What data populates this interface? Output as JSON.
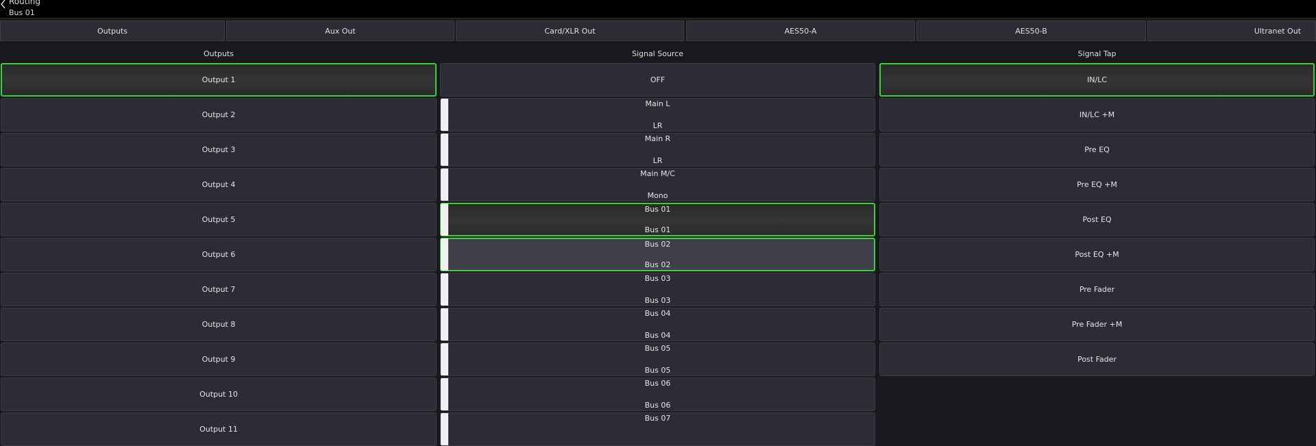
{
  "header": {
    "title": "Routing",
    "subtitle": "Bus 01"
  },
  "tabs": [
    {
      "label": "Outputs",
      "active": true
    },
    {
      "label": "Aux Out"
    },
    {
      "label": "Card/XLR Out"
    },
    {
      "label": "AES50-A"
    },
    {
      "label": "AES50-B"
    },
    {
      "label": "Ultranet Out"
    }
  ],
  "columns": {
    "outputs": "Outputs",
    "signal_source": "Signal Source",
    "signal_tap": "Signal Tap"
  },
  "outputs": [
    {
      "label": "Output 1",
      "state": "selected"
    },
    {
      "label": "Output 2"
    },
    {
      "label": "Output 3"
    },
    {
      "label": "Output 4"
    },
    {
      "label": "Output 5"
    },
    {
      "label": "Output 6"
    },
    {
      "label": "Output 7"
    },
    {
      "label": "Output 8"
    },
    {
      "label": "Output 9"
    },
    {
      "label": "Output 10"
    },
    {
      "label": "Output 11"
    }
  ],
  "sources": [
    {
      "name": "OFF",
      "sub": ""
    },
    {
      "name": "Main L",
      "sub": "LR"
    },
    {
      "name": "Main R",
      "sub": "LR"
    },
    {
      "name": "Main M/C",
      "sub": "Mono"
    },
    {
      "name": "Bus 01",
      "sub": "Bus 01",
      "state": "selected"
    },
    {
      "name": "Bus 02",
      "sub": "Bus 02",
      "state": "highlight"
    },
    {
      "name": "Bus 03",
      "sub": "Bus 03"
    },
    {
      "name": "Bus 04",
      "sub": "Bus 04"
    },
    {
      "name": "Bus 05",
      "sub": "Bus 05"
    },
    {
      "name": "Bus 06",
      "sub": "Bus 06"
    },
    {
      "name": "Bus 07",
      "sub": ""
    }
  ],
  "taps": [
    {
      "label": "IN/LC",
      "state": "selected"
    },
    {
      "label": "IN/LC +M"
    },
    {
      "label": "Pre EQ"
    },
    {
      "label": "Pre EQ +M"
    },
    {
      "label": "Post EQ"
    },
    {
      "label": "Post EQ +M"
    },
    {
      "label": "Pre Fader"
    },
    {
      "label": "Pre Fader +M"
    },
    {
      "label": "Post Fader"
    }
  ],
  "colors": {
    "selected_border": "#3ad13a",
    "button_bg": "#2b2c35",
    "background": "#18191d"
  }
}
